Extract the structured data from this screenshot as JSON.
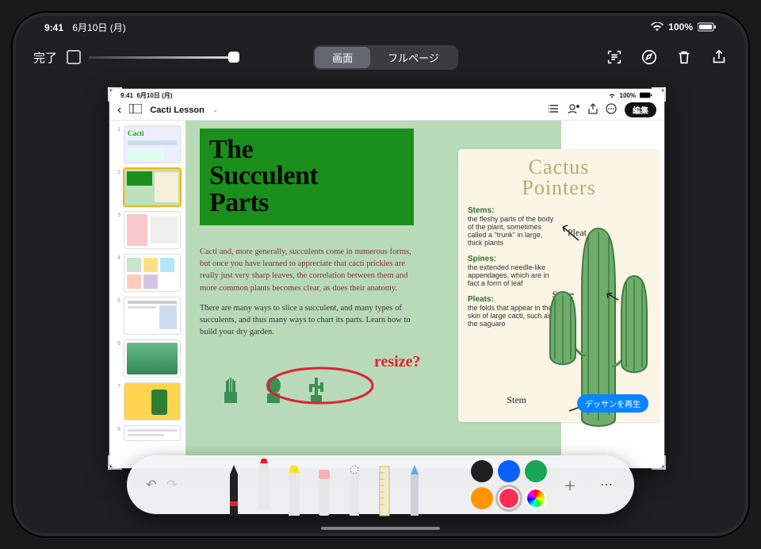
{
  "outer_status": {
    "time": "9:41",
    "date": "6月10日 (月)",
    "battery": "100%"
  },
  "markup_bar": {
    "done": "完了",
    "seg_screen": "画面",
    "seg_fullpage": "フルページ"
  },
  "inner_status": {
    "time": "9:41",
    "date": "6月10日 (月)",
    "battery": "100%"
  },
  "inner_bar": {
    "back": "‹",
    "title": "Cacti Lesson",
    "edit": "編集"
  },
  "thumbs": [
    {
      "n": "1",
      "kind": "cover"
    },
    {
      "n": "2",
      "kind": "succulent",
      "selected": true
    },
    {
      "n": "3",
      "kind": "pink"
    },
    {
      "n": "4",
      "kind": "gallery"
    },
    {
      "n": "5",
      "kind": "article"
    },
    {
      "n": "6",
      "kind": "photo"
    },
    {
      "n": "7",
      "kind": "yellow"
    },
    {
      "n": "8",
      "kind": "text"
    }
  ],
  "page": {
    "title_l1": "The",
    "title_l2": "Succulent",
    "title_l3": "Parts",
    "lead": "Cacti and, more generally, succulents come in numerous forms, but once you have learned to appreciate that cacti prickles are really just very sharp leaves, the correlation between them and more common plants becomes clear, as does their anatomy.",
    "para2": "There are many ways to slice a succulent, and many types of succulents, and thus many ways to chart its parts. Learn how to build your dry garden.",
    "annotation": "resize?"
  },
  "card": {
    "title_l1": "Cactus",
    "title_l2": "Pointers",
    "stems_h": "Stems:",
    "stems_b": "the fleshy parts of the body of the plant, sometimes called a \"trunk\" in large, thick plants",
    "spines_h": "Spines:",
    "spines_b": "the extended needle-like appendages, which are in fact a form of leaf",
    "pleats_h": "Pleats:",
    "pleats_b": "the folds that appear in the skin of large cacti, such as the saguaro",
    "lbl_pleat": "Pleat",
    "lbl_spine": "Spine",
    "lbl_stem": "Stem",
    "replay": "デッサンを再生"
  },
  "swatches": {
    "c1": "#1f1f1f",
    "c2": "#0a60ff",
    "c3": "#18a558",
    "c4": "#ff9500",
    "c5": "#ff2d55"
  },
  "tools": {
    "undo": "↶",
    "redo": "↷",
    "plus": "＋",
    "more": "⋯"
  }
}
